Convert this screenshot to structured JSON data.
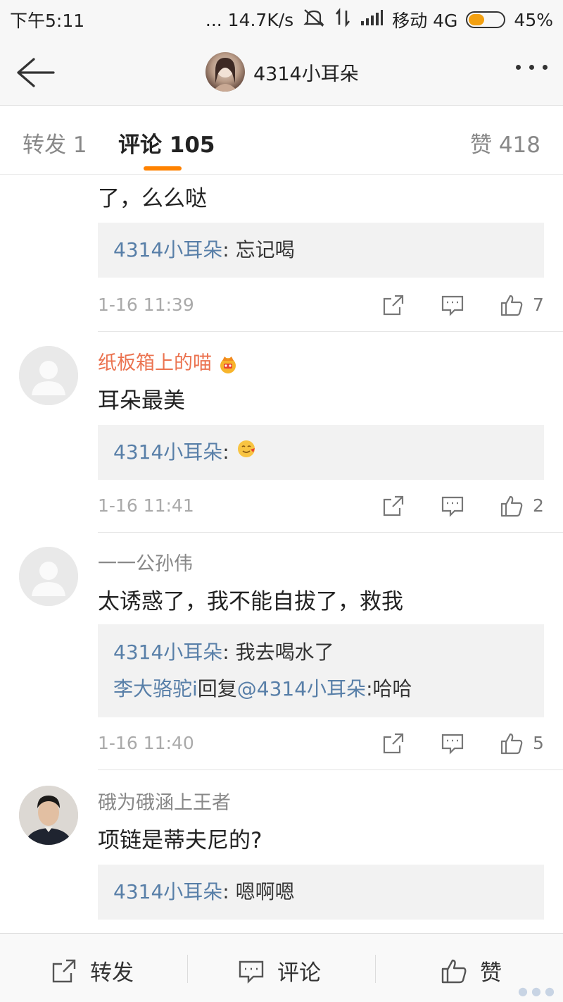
{
  "status_bar": {
    "time": "下午5:11",
    "network_speed": "... 14.7K/s",
    "carrier": "移动 4G",
    "battery_percent": "45%",
    "battery_level": 0.45
  },
  "nav": {
    "title": "4314小耳朵",
    "back_icon": "arrow-left-icon",
    "more_icon": "more-dots-icon"
  },
  "tabs": {
    "repost": "转发 1",
    "comment": "评论 105",
    "like": "赞 418",
    "active_color": "#ff8200"
  },
  "comments": [
    {
      "partial_text": "了，么么哒",
      "replies": [
        {
          "name": "4314小耳朵",
          "text": ": 忘记喝"
        }
      ],
      "time": "1-16 11:39",
      "likes": "7"
    },
    {
      "name": "纸板箱上的喵",
      "text": "耳朵最美",
      "replies": [
        {
          "name": "4314小耳朵",
          "text": ": "
        }
      ],
      "time": "1-16 11:41",
      "likes": "2"
    },
    {
      "name": "一一公孙伟",
      "text": "太诱惑了，我不能自拔了，救我",
      "replies": [
        {
          "name": "4314小耳朵",
          "text": ": 我去喝水了"
        },
        {
          "name": "李大骆驼i",
          "text": "回复",
          "mention": "@4314小耳朵",
          "suffix": ":哈哈"
        }
      ],
      "time": "1-16 11:40",
      "likes": "5"
    },
    {
      "name": "硪为硪涵上王者",
      "text": "项链是蒂夫尼的?",
      "replies": [
        {
          "name": "4314小耳朵",
          "text": ": 嗯啊嗯"
        }
      ]
    }
  ],
  "bottom_bar": {
    "repost": "转发",
    "comment": "评论",
    "like": "赞"
  },
  "colors": {
    "link": "#587fa8",
    "vip_name": "#eb7350",
    "accent": "#ff8200"
  }
}
